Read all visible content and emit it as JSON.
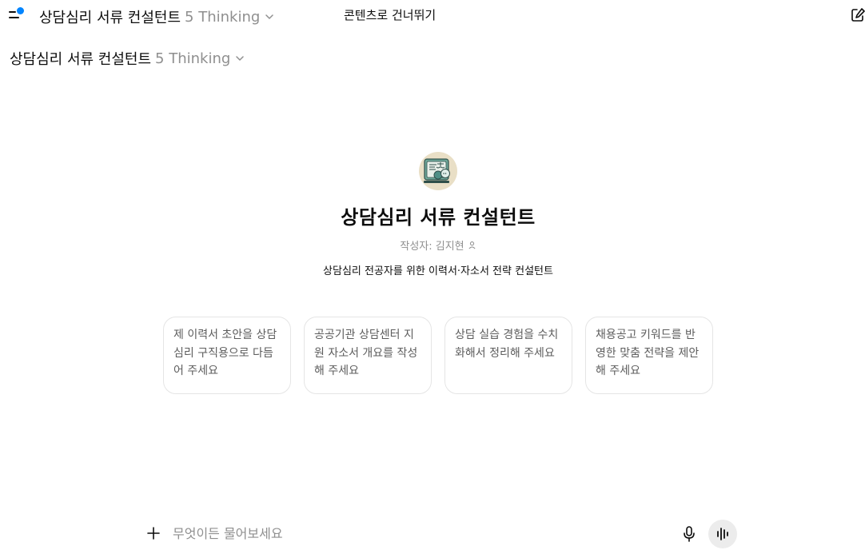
{
  "header": {
    "model_name": "상담심리 서류 컨설턴트",
    "model_version": "5 Thinking",
    "skip_link": "콘텐츠로 건너뛰기",
    "icons": {
      "sidebar": "sidebar-toggle-icon",
      "new_chat": "new-chat-icon",
      "chevron": "chevron-down-icon"
    }
  },
  "gpt": {
    "title": "상담심리 서류 컨설턴트",
    "author_label": "작성자: 김지현",
    "description": "상담심리 전공자를 위한 이력서·자소서 전략 컨설턴트"
  },
  "starters": [
    {
      "label": "제 이력서 초안을 상담심리 구직용으로 다듬어 주세요"
    },
    {
      "label": "공공기관 상담센터 지원 자소서 개요를 작성해 주세요"
    },
    {
      "label": "상담 실습 경험을 수치화해서 정리해 주세요"
    },
    {
      "label": "채용공고 키워드를 반영한 맞춤 전략을 제안해 주세요"
    }
  ],
  "composer": {
    "placeholder": "무엇이든 물어보세요",
    "value": ""
  },
  "colors": {
    "accent_dot": "#0285ff",
    "muted_text": "#8f8f8f",
    "border": "#e5e5e5"
  }
}
